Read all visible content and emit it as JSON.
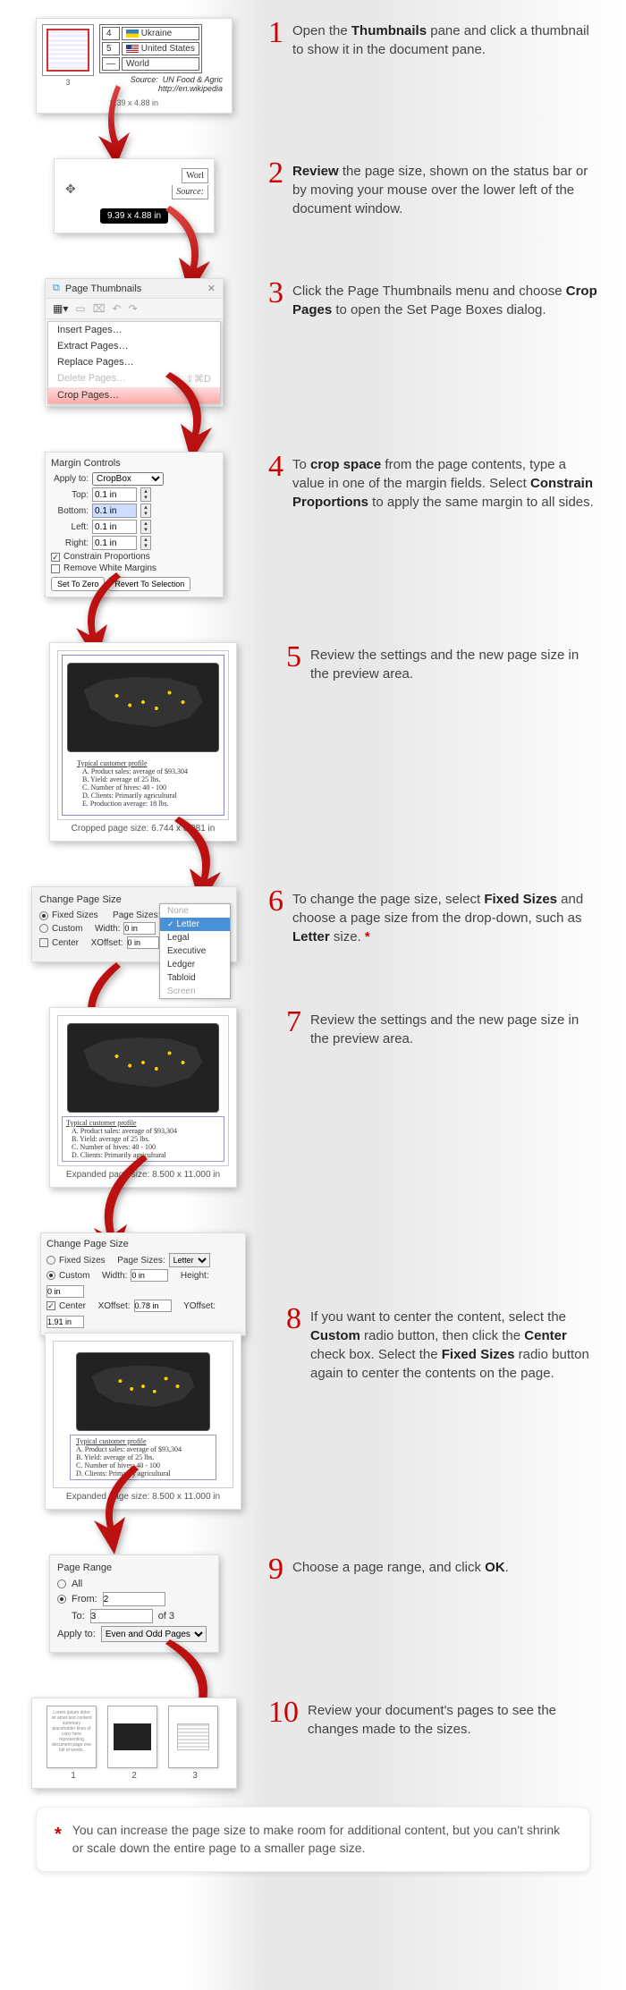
{
  "steps": {
    "s1": {
      "num": "1",
      "t1": "Open the ",
      "b1": "Thumbnails",
      "t2": " pane and click a thumbnail to show it in the document pane."
    },
    "s2": {
      "num": "2",
      "b1": "Review",
      "t1": " the page size, shown on the status bar or by moving your mouse over the lower left of the document window."
    },
    "s3": {
      "num": "3",
      "t1": "Click the Page Thumbnails menu and choose ",
      "b1": "Crop Pages",
      "t2": " to open the Set Page Boxes dialog."
    },
    "s4": {
      "num": "4",
      "t1": "To ",
      "b1": "crop space",
      "t2": " from the page contents, type a value in one of the margin fields. Select ",
      "b2": "Constrain Proportions",
      "t3": " to apply the same margin to all sides."
    },
    "s5": {
      "num": "5",
      "t1": "Review the settings and the new page size in the preview area."
    },
    "s6": {
      "num": "6",
      "t1": "To change the page size, select ",
      "b1": "Fixed Sizes",
      "t2": " and choose a page size from the drop-down, such as ",
      "b2": "Letter",
      "t3": " size. "
    },
    "s7": {
      "num": "7",
      "t1": "Review the settings and the new page size in the preview area."
    },
    "s8": {
      "num": "8",
      "t1": "If you want to center the content, select the ",
      "b1": "Custom",
      "t2": " radio button, then click the ",
      "b2": "Center",
      "t3": " check box. Select the ",
      "b3": "Fixed Sizes",
      "t4": " radio button again to center the contents on the page."
    },
    "s9": {
      "num": "9",
      "t1": "Choose a page range, and click ",
      "b1": "OK",
      "t2": "."
    },
    "s10": {
      "num": "10",
      "t1": "Review your document's pages to see the changes made to the sizes."
    }
  },
  "shot1": {
    "r1n": "4",
    "r1c": "Ukraine",
    "r2n": "5",
    "r2c": "United States",
    "r3n": "—",
    "r3c": "World",
    "src_lbl": "Source:",
    "src_val": "UN Food & Agric\nhttp://en.wikipedia",
    "size": "9.39 x 4.88 in",
    "thumb_num": "3"
  },
  "shot2": {
    "word": "Worl",
    "src": "Source:",
    "tooltip": "9.39 x 4.88 in"
  },
  "shot3": {
    "title": "Page Thumbnails",
    "menu": {
      "insert": "Insert Pages…",
      "extract": "Extract Pages…",
      "replace": "Replace Pages…",
      "delete": "Delete Pages…",
      "shortcut": "⇧⌘D",
      "crop": "Crop Pages…"
    }
  },
  "shot4": {
    "title": "Margin Controls",
    "apply": "Apply to:",
    "apply_val": "CropBox",
    "top": "Top:",
    "bottom": "Bottom:",
    "left": "Left:",
    "right": "Right:",
    "val": "0.1 in",
    "constrain": "Constrain Proportions",
    "remove": "Remove White Margins",
    "zero": "Set To Zero",
    "revert": "Revert To Selection"
  },
  "shot5": {
    "profile_title": "Typical customer profile",
    "la": "A.",
    "a": "Product sales: average of $93,304",
    "lb": "B.",
    "b": "Yield: average of 25 lbs.",
    "lc": "C.",
    "c": "Number of hives: 40 - 100",
    "ld": "D.",
    "d": "Clients: Primarily agricultural",
    "le": "E.",
    "e": "Production average: 18 lbs.",
    "cap": "Cropped page size: 6.744 x 6.981 in"
  },
  "shot6": {
    "title": "Change Page Size",
    "fixed": "Fixed Sizes",
    "psizes": "Page Sizes:",
    "custom": "Custom",
    "width": "Width:",
    "wval": "0 in",
    "center": "Center",
    "xoff": "XOffset:",
    "xval": "0 in",
    "dd": {
      "none": "None",
      "letter": "Letter",
      "legal": "Legal",
      "exec": "Executive",
      "ledger": "Ledger",
      "tabloid": "Tabloid",
      "screen": "Screen"
    }
  },
  "shot7": {
    "profile_title": "Typical customer profile",
    "a": "Product sales: average of $93,304",
    "b": "Yield: average of 25 lbs.",
    "c": "Number of hives: 40 - 100",
    "d": "Clients: Primarily agricultural",
    "cap": "Expanded page size: 8.500 x 11.000 in"
  },
  "shot8a": {
    "title": "Change Page Size",
    "fixed": "Fixed Sizes",
    "psizes": "Page Sizes:",
    "psval": "Letter",
    "custom": "Custom",
    "width": "Width:",
    "wval": "0 in",
    "height": "Height:",
    "hval": "0 in",
    "center": "Center",
    "xoff": "XOffset:",
    "xval": "0.78 in",
    "yoff": "YOffset:",
    "yval": "1.91 in"
  },
  "shot8b": {
    "cap": "Expanded page size: 8.500 x 11.000 in"
  },
  "shot9": {
    "title": "Page Range",
    "all": "All",
    "from": "From:",
    "from_val": "2",
    "to": "To:",
    "to_val": "3",
    "of": "of 3",
    "apply": "Apply to:",
    "apply_val": "Even and Odd Pages"
  },
  "shot10": {
    "p1": "1",
    "p2": "2",
    "p3": "3"
  },
  "note": {
    "star": "*",
    "text": "You can increase the page size to make room for additional content, but you can't shrink or scale down the entire page to a smaller page size."
  }
}
